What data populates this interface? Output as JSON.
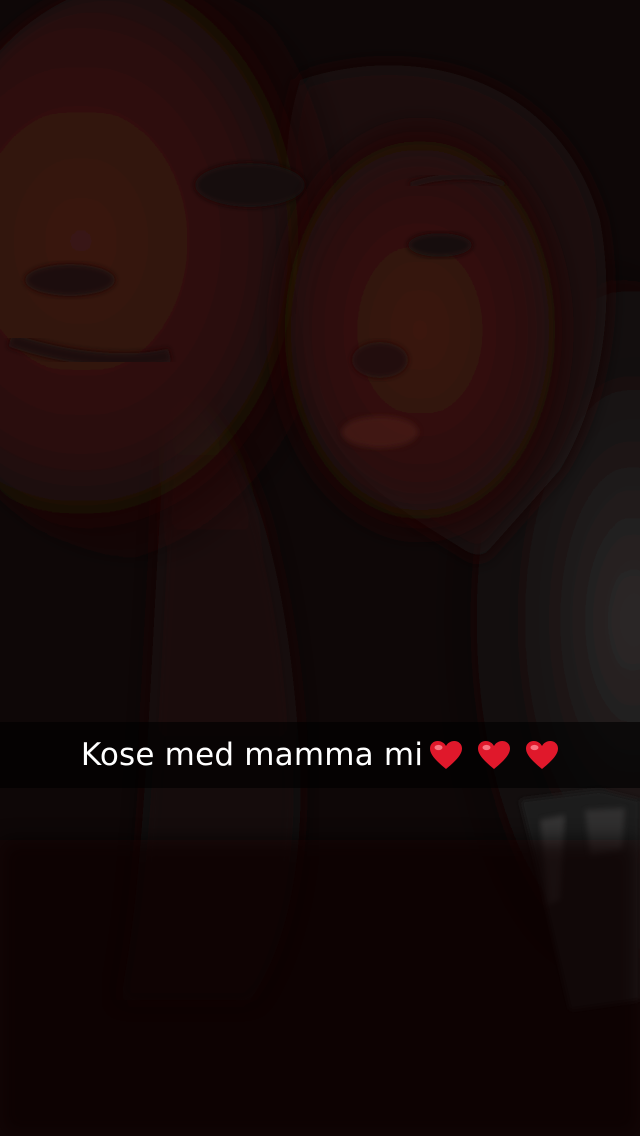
{
  "snap": {
    "caption": "Kose med mamma mi",
    "caption_emoji": [
      "red-heart-icon",
      "red-heart-icon",
      "red-heart-icon"
    ],
    "colors": {
      "background": "#0d0707",
      "caption_bar": "#000000",
      "caption_text": "#ffffff",
      "heart": "#e0182b"
    }
  }
}
